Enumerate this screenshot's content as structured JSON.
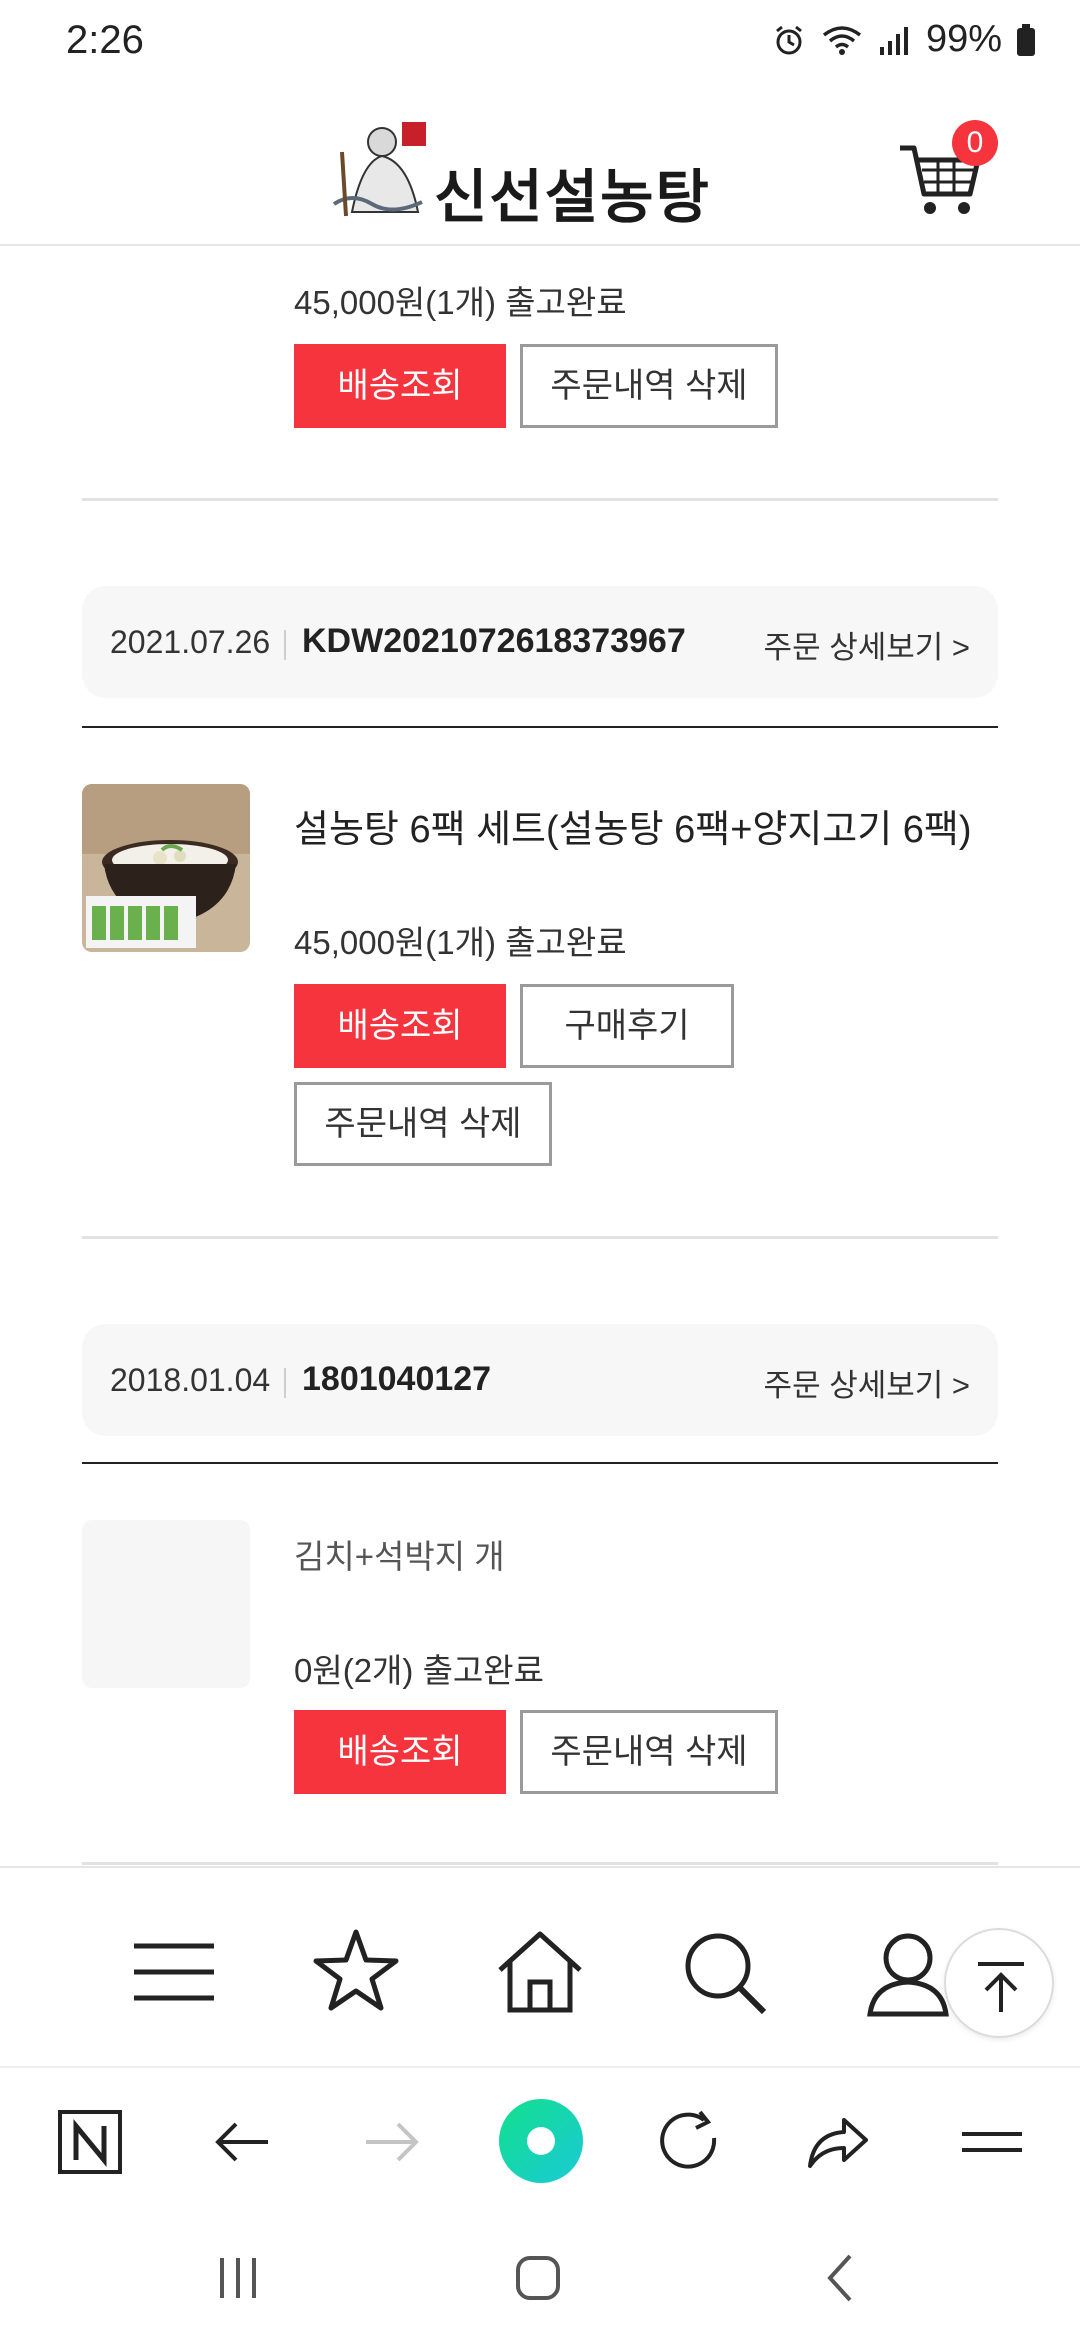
{
  "status_bar": {
    "time": "2:26",
    "battery": "99%"
  },
  "header": {
    "logo_text": "신선설농탕",
    "cart_count": "0"
  },
  "orders": {
    "top_partial": {
      "price_line": "45,000원(1개) 출고완료",
      "track_button": "배송조회",
      "delete_button": "주문내역 삭제"
    },
    "order1": {
      "date": "2021.07.26",
      "order_no": "KDW2021072618373967",
      "detail_link": "주문 상세보기 >",
      "product_name": "설농탕 6팩 세트(설농탕 6팩+양지고기 6팩)",
      "price_line": "45,000원(1개) 출고완료",
      "track_button": "배송조회",
      "review_button": "구매후기",
      "delete_button": "주문내역 삭제"
    },
    "order2": {
      "date": "2018.01.04",
      "order_no": "1801040127",
      "detail_link": "주문 상세보기 >",
      "product_name": "김치+석박지 개",
      "price_line": "0원(2개) 출고완료",
      "track_button": "배송조회",
      "delete_button": "주문내역 삭제"
    }
  },
  "site_nav": {
    "items": [
      "menu-icon",
      "star-icon",
      "home-icon",
      "search-icon",
      "person-icon"
    ],
    "to_top": "arrow-up-icon"
  },
  "browser_bar": {
    "items": [
      "naver-n-icon",
      "back-icon",
      "forward-icon",
      "green-dot-icon",
      "reload-icon",
      "share-icon",
      "menu-icon"
    ]
  },
  "colors": {
    "accent_red": "#f5343e",
    "green": "#1fd7a1"
  }
}
